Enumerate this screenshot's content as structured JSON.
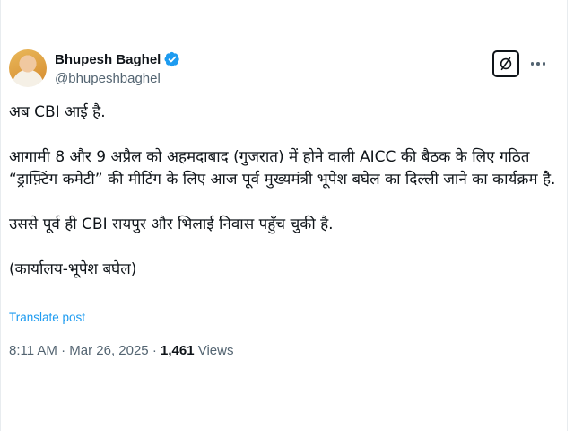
{
  "author": {
    "name": "Bhupesh Baghel",
    "handle": "@bhupeshbaghel"
  },
  "post": {
    "paragraphs": [
      "अब CBI आई है.",
      "आगामी 8 और 9 अप्रैल को अहमदाबाद (गुजरात) में होने वाली AICC की बैठक के लिए गठित “ड्राफ़्टिंग कमेटी” की मीटिंग के लिए आज पूर्व मुख्यमंत्री भूपेश बघेल का दिल्ली जाने का कार्यक्रम है.",
      "उससे पूर्व ही CBI रायपुर और भिलाई निवास पहुँच चुकी है.",
      "(कार्यालय-भूपेश बघेल)"
    ],
    "translate_label": "Translate post"
  },
  "meta": {
    "time": "8:11 AM",
    "separator": "·",
    "date": "Mar 26, 2025",
    "views_count": "1,461",
    "views_label": "Views"
  },
  "icons": {
    "verified": "verified-badge-icon",
    "grok": "grok-icon",
    "more": "more-options-icon"
  },
  "colors": {
    "accent": "#1d9bf0",
    "text": "#0f1419",
    "secondary": "#536471"
  }
}
